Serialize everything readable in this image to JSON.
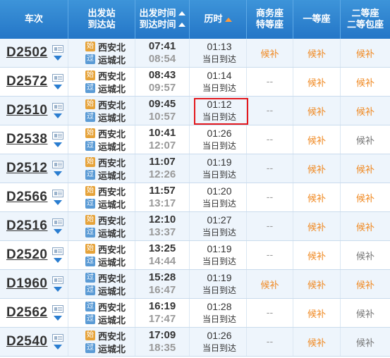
{
  "header": {
    "train": "车次",
    "stations_l1": "出发站",
    "stations_l2": "到达站",
    "times_l1": "出发时间",
    "times_l2": "到达时间",
    "duration": "历时",
    "business_l1": "商务座",
    "business_l2": "特等座",
    "first": "一等座",
    "second_l1": "二等座",
    "second_l2": "二等包座"
  },
  "badges": {
    "start": "始",
    "pass": "过"
  },
  "rows": [
    {
      "train": "D2502",
      "from": "西安北",
      "to": "运城北",
      "from_badge": "始",
      "dep": "07:41",
      "arr": "08:54",
      "dur": "01:13",
      "note": "当日到达",
      "biz": "候补",
      "first": "候补",
      "second": "候补"
    },
    {
      "train": "D2572",
      "from": "西安北",
      "to": "运城北",
      "from_badge": "始",
      "dep": "08:43",
      "arr": "09:57",
      "dur": "01:14",
      "note": "当日到达",
      "biz": "--",
      "first": "候补",
      "second": "候补"
    },
    {
      "train": "D2510",
      "from": "西安北",
      "to": "运城北",
      "from_badge": "始",
      "dep": "09:45",
      "arr": "10:57",
      "dur": "01:12",
      "note": "当日到达",
      "biz": "--",
      "first": "候补",
      "second": "候补"
    },
    {
      "train": "D2538",
      "from": "西安北",
      "to": "运城北",
      "from_badge": "始",
      "dep": "10:41",
      "arr": "12:07",
      "dur": "01:26",
      "note": "当日到达",
      "biz": "--",
      "first": "候补",
      "second": "候补"
    },
    {
      "train": "D2512",
      "from": "西安北",
      "to": "运城北",
      "from_badge": "始",
      "dep": "11:07",
      "arr": "12:26",
      "dur": "01:19",
      "note": "当日到达",
      "biz": "--",
      "first": "候补",
      "second": "候补"
    },
    {
      "train": "D2566",
      "from": "西安北",
      "to": "运城北",
      "from_badge": "始",
      "dep": "11:57",
      "arr": "13:17",
      "dur": "01:20",
      "note": "当日到达",
      "biz": "--",
      "first": "候补",
      "second": "候补"
    },
    {
      "train": "D2516",
      "from": "西安北",
      "to": "运城北",
      "from_badge": "始",
      "dep": "12:10",
      "arr": "13:37",
      "dur": "01:27",
      "note": "当日到达",
      "biz": "--",
      "first": "候补",
      "second": "候补"
    },
    {
      "train": "D2520",
      "from": "西安北",
      "to": "运城北",
      "from_badge": "始",
      "dep": "13:25",
      "arr": "14:44",
      "dur": "01:19",
      "note": "当日到达",
      "biz": "--",
      "first": "候补",
      "second": "候补"
    },
    {
      "train": "D1960",
      "from": "西安北",
      "to": "运城北",
      "from_badge": "过",
      "dep": "15:28",
      "arr": "16:47",
      "dur": "01:19",
      "note": "当日到达",
      "biz": "候补",
      "first": "候补",
      "second": "候补"
    },
    {
      "train": "D2562",
      "from": "西安北",
      "to": "运城北",
      "from_badge": "过",
      "dep": "16:19",
      "arr": "17:47",
      "dur": "01:28",
      "note": "当日到达",
      "biz": "--",
      "first": "候补",
      "second": "候补"
    },
    {
      "train": "D2540",
      "from": "西安北",
      "to": "运城北",
      "from_badge": "始",
      "dep": "17:09",
      "arr": "18:35",
      "dur": "01:26",
      "note": "当日到达",
      "biz": "--",
      "first": "候补",
      "second": "候补"
    }
  ],
  "colors": {
    "header_bg": "#2a7dd0",
    "accent_orange": "#f08a24",
    "highlight": "#e3181d"
  }
}
